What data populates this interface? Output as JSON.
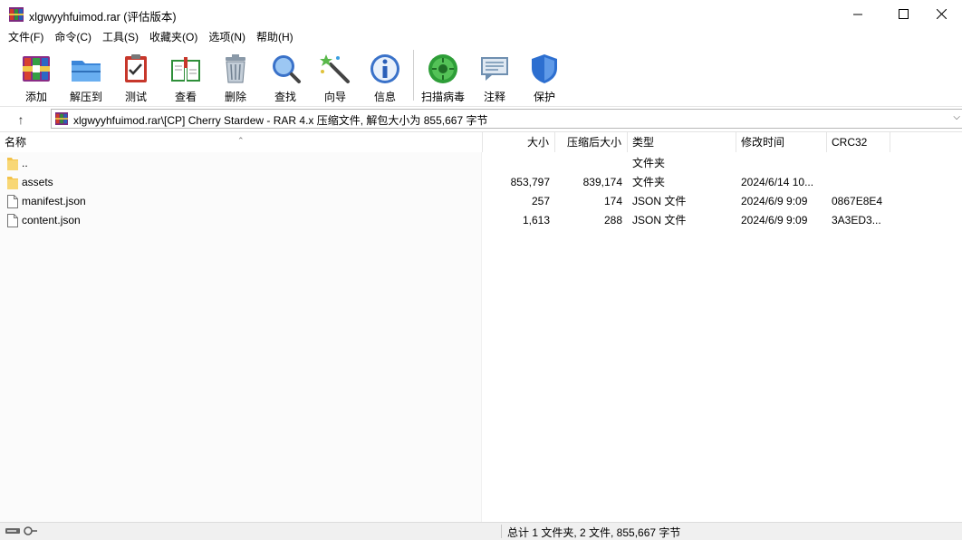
{
  "window": {
    "title": "xlgwyyhfuimod.rar (评估版本)",
    "minimize_glyph": "—",
    "maximize_glyph": "☐",
    "close_glyph": "✕"
  },
  "menu": [
    "文件(F)",
    "命令(C)",
    "工具(S)",
    "收藏夹(O)",
    "选项(N)",
    "帮助(H)"
  ],
  "toolbar": [
    {
      "label": "添加",
      "icon": "add-archive-icon"
    },
    {
      "label": "解压到",
      "icon": "extract-folder-icon"
    },
    {
      "label": "测试",
      "icon": "test-clipboard-icon"
    },
    {
      "label": "查看",
      "icon": "view-book-icon"
    },
    {
      "label": "删除",
      "icon": "trash-icon"
    },
    {
      "label": "查找",
      "icon": "magnifier-icon"
    },
    {
      "label": "向导",
      "icon": "wizard-wand-icon"
    },
    {
      "label": "信息",
      "icon": "info-icon"
    },
    {
      "label": "扫描病毒",
      "icon": "virus-scan-icon"
    },
    {
      "label": "注释",
      "icon": "comment-icon"
    },
    {
      "label": "保护",
      "icon": "shield-icon"
    }
  ],
  "address": {
    "up_glyph": "↑",
    "path": "xlgwyyhfuimod.rar\\[CP] Cherry Stardew - RAR 4.x 压缩文件, 解包大小为 855,667 字节",
    "dropdown_glyph": "⌵"
  },
  "columns": {
    "name": "名称",
    "size": "大小",
    "packed": "压缩后大小",
    "type": "类型",
    "modified": "修改时间",
    "crc": "CRC32"
  },
  "sort_glyph": "⌃",
  "files": [
    {
      "name": "..",
      "kind": "folder",
      "size": "",
      "packed": "",
      "type": "文件夹",
      "modified": "",
      "crc": ""
    },
    {
      "name": "assets",
      "kind": "folder",
      "size": "853,797",
      "packed": "839,174",
      "type": "文件夹",
      "modified": "2024/6/14 10...",
      "crc": ""
    },
    {
      "name": "manifest.json",
      "kind": "file",
      "size": "257",
      "packed": "174",
      "type": "JSON 文件",
      "modified": "2024/6/9 9:09",
      "crc": "0867E8E4"
    },
    {
      "name": "content.json",
      "kind": "file",
      "size": "1,613",
      "packed": "288",
      "type": "JSON 文件",
      "modified": "2024/6/9 9:09",
      "crc": "3A3ED3..."
    }
  ],
  "status": {
    "summary": "总计 1 文件夹, 2 文件, 855,667 字节"
  }
}
